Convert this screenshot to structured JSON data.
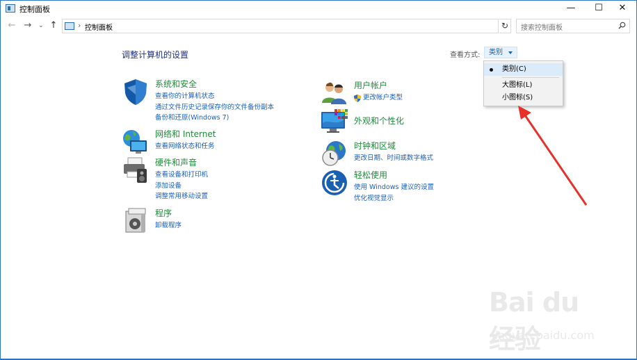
{
  "window": {
    "title": "控制面板",
    "minimize": "—",
    "maximize": "☐",
    "close": "✕"
  },
  "nav": {
    "back": "←",
    "forward": "→",
    "recent": "⌄",
    "up": "↑",
    "breadcrumb": "控制面板",
    "separator": "›",
    "refresh": "↻",
    "search_placeholder": "搜索控制面板"
  },
  "main": {
    "heading": "调整计算机的设置",
    "view_by_label": "查看方式:",
    "view_by_value": "类别"
  },
  "categories": [
    {
      "name": "系统和安全",
      "icon": "shield-icon",
      "links": [
        "查看你的计算机状态",
        "通过文件历史记录保存你的文件备份副本",
        "备份和还原(Windows 7)"
      ]
    },
    {
      "name": "网络和 Internet",
      "icon": "network-globe-icon",
      "links": [
        "查看网络状态和任务"
      ]
    },
    {
      "name": "硬件和声音",
      "icon": "printer-speaker-icon",
      "links": [
        "查看设备和打印机",
        "添加设备",
        "调整常用移动设置"
      ]
    },
    {
      "name": "程序",
      "icon": "programs-icon",
      "links": [
        "卸载程序"
      ]
    },
    {
      "name": "用户帐户",
      "icon": "users-icon",
      "links": [
        "更改帐户类型"
      ]
    },
    {
      "name": "外观和个性化",
      "icon": "monitor-palette-icon",
      "links": []
    },
    {
      "name": "时钟和区域",
      "icon": "clock-globe-icon",
      "links": [
        "更改日期、时间或数字格式"
      ]
    },
    {
      "name": "轻松使用",
      "icon": "ease-of-access-icon",
      "links": [
        "使用 Windows 建议的设置",
        "优化视觉显示"
      ]
    }
  ],
  "menu": {
    "items": [
      "类别(C)",
      "大图标(L)",
      "小图标(S)"
    ],
    "selected": "类别(C)"
  },
  "watermark": {
    "logo": "Bai du 经验",
    "url": "jingyan.baidu.com"
  },
  "colors": {
    "link": "#1a5fc0",
    "category": "#1f8a3a",
    "heading": "#1e3287",
    "arrow": "#e8302b"
  }
}
